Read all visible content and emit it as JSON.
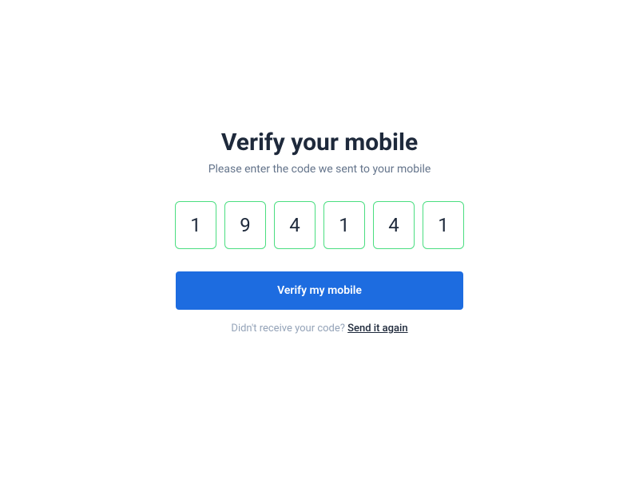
{
  "header": {
    "title": "Verify your mobile",
    "subtitle": "Please enter the code we sent to your mobile"
  },
  "code": {
    "digits": [
      "1",
      "9",
      "4",
      "1",
      "4",
      "1"
    ]
  },
  "actions": {
    "verify_label": "Verify my mobile",
    "resend_prompt": "Didn't receive your code? ",
    "resend_link": "Send it again"
  }
}
